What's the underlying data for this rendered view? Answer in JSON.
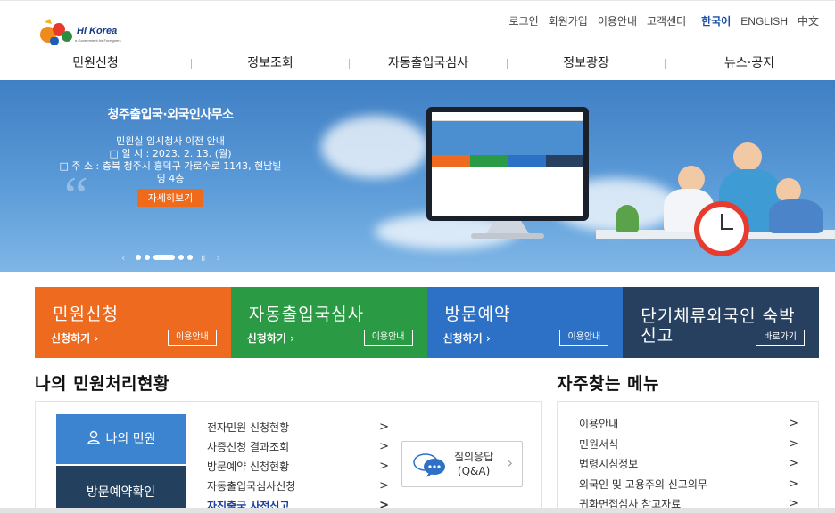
{
  "header": {
    "logo_text": "Hi Korea",
    "logo_sub": "e-Government for Foreigners",
    "util_links": [
      "로그인",
      "회원가입",
      "이용안내",
      "고객센터"
    ],
    "languages": [
      "한국어",
      "ENGLISH",
      "中文"
    ],
    "active_language": "한국어",
    "nav": [
      "민원신청",
      "정보조회",
      "자동출입국심사",
      "정보광장",
      "뉴스·공지"
    ]
  },
  "hero": {
    "title": "청주출입국·외국인사무소",
    "lines": [
      "민원실 임시청사 이전 안내",
      "□ 일 시 : 2023. 2. 13. (월)",
      "□ 주 소 : 충북 청주시 흥덕구 가로수로 1143, 현남빌",
      "딩 4층"
    ],
    "button": "자세히보기",
    "pager_prev": "‹",
    "pager_next": "›",
    "pager_pause": "॥"
  },
  "tiles": [
    {
      "name": "민원신청",
      "sub": "신청하기",
      "btn": "이용안내",
      "color": "#ee6a1f"
    },
    {
      "name": "자동출입국심사",
      "sub": "신청하기",
      "btn": "이용안내",
      "color": "#2b9a45"
    },
    {
      "name": "방문예약",
      "sub": "신청하기",
      "btn": "이용안내",
      "color": "#2c71c6"
    },
    {
      "name_line1": "단기체류외국인 숙박",
      "name_line2": "신고",
      "btn": "바로가기",
      "color": "#27405f"
    }
  ],
  "my_status": {
    "title": "나의 민원처리현황",
    "side_buttons": [
      "나의 민원",
      "방문예약확인"
    ],
    "links": [
      "전자민원 신청현황",
      "사증신청 결과조회",
      "방문예약 신청현황",
      "자동출입국심사신청",
      "자진출국 사전신고"
    ],
    "qa_line1": "질의응답",
    "qa_line2": "(Q&A)"
  },
  "frequent_menu": {
    "title": "자주찾는 메뉴",
    "items": [
      "이용안내",
      "민원서식",
      "법령지침정보",
      "외국인 및 고용주의 신고의무",
      "귀화면접심사 참고자료"
    ]
  },
  "glyphs": {
    "chevron": "›",
    "arrow": ">"
  }
}
